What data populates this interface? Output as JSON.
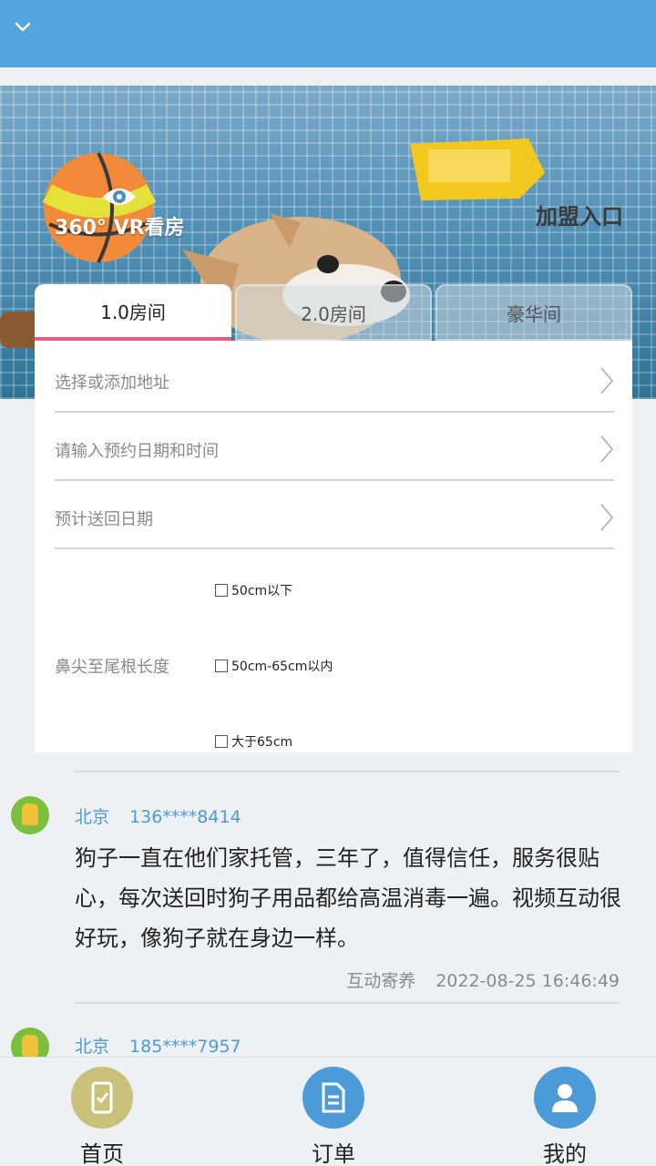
{
  "header": {
    "collapse_icon": "chevron-down-icon",
    "color": "#55a3df"
  },
  "banner": {
    "vr_label": "360° VR看房",
    "join_label": "加盟入口"
  },
  "tabs": [
    {
      "label": "1.0房间",
      "active": true
    },
    {
      "label": "2.0房间",
      "active": false
    },
    {
      "label": "豪华间",
      "active": false
    }
  ],
  "form": {
    "address_placeholder": "选择或添加地址",
    "appointment_placeholder": "请输入预约日期和时间",
    "return_date_placeholder": "预计送回日期",
    "size_label": "鼻尖至尾根长度",
    "size_options": [
      "50cm以下",
      "50cm-65cm以内",
      "大于65cm"
    ]
  },
  "reviews": [
    {
      "city": "北京",
      "phone": "136****8414",
      "content": "狗子一直在他们家托管，三年了，值得信任，服务很贴心，每次送回时狗子用品都给高温消毒一遍。视频互动很好玩，像狗子就在身边一样。",
      "service": "互动寄养",
      "time": "2022-08-25 16:46:49"
    },
    {
      "city": "北京",
      "phone": "185****7957"
    }
  ],
  "nav": [
    {
      "label": "首页",
      "icon": "phone-check-icon",
      "color": "#c9c07a"
    },
    {
      "label": "订单",
      "icon": "document-icon",
      "color": "#4c9ad8"
    },
    {
      "label": "我的",
      "icon": "user-icon",
      "color": "#4c9ad8"
    }
  ]
}
